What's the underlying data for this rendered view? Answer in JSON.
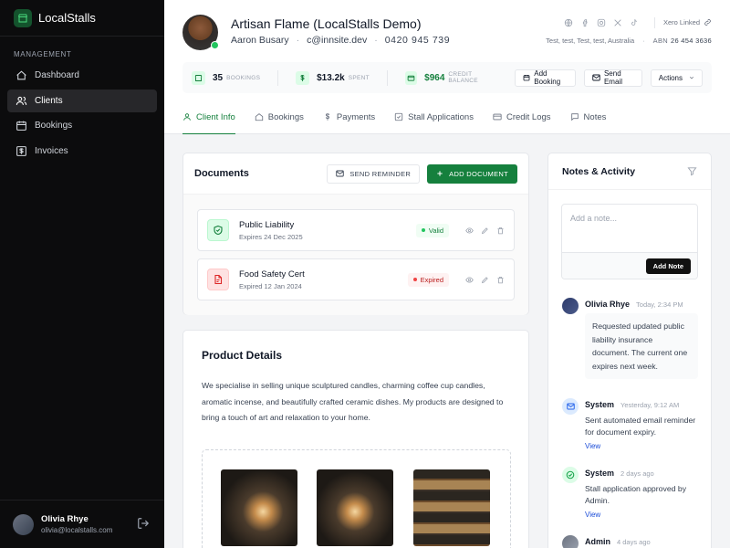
{
  "brand": {
    "name": "LocalStalls"
  },
  "sidebar": {
    "section": "MANAGEMENT",
    "items": [
      {
        "label": "Dashboard",
        "icon": "dashboard-icon"
      },
      {
        "label": "Clients",
        "icon": "users-icon",
        "active": true
      },
      {
        "label": "Bookings",
        "icon": "calendar-icon"
      },
      {
        "label": "Invoices",
        "icon": "dollar-icon"
      }
    ],
    "user": {
      "name": "Olivia Rhye",
      "email": "olivia@localstalls.com"
    }
  },
  "client": {
    "title": "Artisan Flame (LocalStalls Demo)",
    "contact": "Aaron Busary",
    "email": "c@innsite.dev",
    "phone": "0420 945 739",
    "xero": "Xero Linked",
    "address": "Test, test, Test, test, Australia",
    "abn_label": "ABN",
    "abn": "26 454 3636"
  },
  "stats": {
    "bookings": {
      "value": "35",
      "label": "BOOKINGS"
    },
    "spent": {
      "value": "$13.2k",
      "label": "SPENT"
    },
    "credit": {
      "value": "$964",
      "label": "CREDIT BALANCE"
    },
    "actions": {
      "add_booking": "Add Booking",
      "send_email": "Send Email",
      "actions": "Actions"
    }
  },
  "tabs": [
    {
      "label": "Client Info",
      "icon": "user-icon",
      "active": true
    },
    {
      "label": "Bookings",
      "icon": "home-icon"
    },
    {
      "label": "Payments",
      "icon": "dollar-icon"
    },
    {
      "label": "Stall Applications",
      "icon": "checkbox-icon"
    },
    {
      "label": "Credit Logs",
      "icon": "card-icon"
    },
    {
      "label": "Notes",
      "icon": "message-icon"
    }
  ],
  "documents": {
    "title": "Documents",
    "send_reminder": "SEND REMINDER",
    "add_document": "ADD DOCUMENT",
    "items": [
      {
        "name": "Public Liability",
        "sub": "Expires 24 Dec 2025",
        "status": "Valid"
      },
      {
        "name": "Food Safety Cert",
        "sub": "Expired 12 Jan 2024",
        "status": "Expired"
      }
    ]
  },
  "product": {
    "title": "Product Details",
    "description": "We specialise in selling unique sculptured candles, charming coffee cup candles, aromatic incense, and beautifully crafted ceramic dishes. My products are designed to bring a touch of art and relaxation to your home."
  },
  "notes": {
    "title": "Notes & Activity",
    "placeholder": "Add a note...",
    "add_button": "Add Note",
    "activity": [
      {
        "name": "Olivia Rhye",
        "time": "Today, 2:34 PM",
        "text": "Requested updated public liability insurance document. The current one expires next week."
      },
      {
        "name": "System",
        "time": "Yesterday, 9:12 AM",
        "text": "Sent automated email reminder for document expiry.",
        "link": "View"
      },
      {
        "name": "System",
        "time": "2 days ago",
        "text": "Stall application approved by Admin.",
        "link": "View"
      },
      {
        "name": "Admin",
        "time": "4 days ago"
      }
    ]
  },
  "colors": {
    "accent": "#15803d",
    "sidebar": "#0c0c0d",
    "danger": "#b91c1c"
  }
}
